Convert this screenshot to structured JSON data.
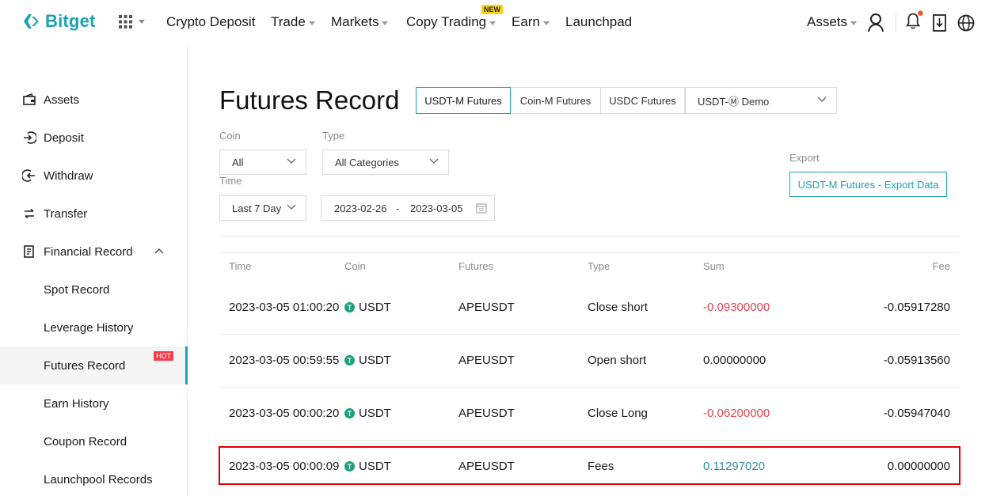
{
  "nav": {
    "logo": "Bitget",
    "items": [
      "Crypto Deposit",
      "Trade",
      "Markets",
      "Copy Trading",
      "Earn",
      "Launchpad"
    ],
    "new_badge": "NEW",
    "assets": "Assets"
  },
  "sidebar": {
    "items": [
      {
        "label": "Assets",
        "icon": "wallet-icon"
      },
      {
        "label": "Deposit",
        "icon": "deposit-icon"
      },
      {
        "label": "Withdraw",
        "icon": "withdraw-icon"
      },
      {
        "label": "Transfer",
        "icon": "transfer-icon"
      },
      {
        "label": "Financial Record",
        "icon": "document-icon"
      },
      {
        "label": "Spot Record"
      },
      {
        "label": "Leverage History"
      },
      {
        "label": "Futures Record",
        "badge": "HOT",
        "active": true
      },
      {
        "label": "Earn History"
      },
      {
        "label": "Coupon Record"
      },
      {
        "label": "Launchpool Records"
      }
    ]
  },
  "main": {
    "title": "Futures Record",
    "tabs": [
      "USDT-M Futures",
      "Coin-M Futures",
      "USDC Futures"
    ],
    "demo_select": "USDT-Ⓜ Demo",
    "filters": {
      "coin_label": "Coin",
      "coin_value": "All",
      "type_label": "Type",
      "type_value": "All Categories",
      "time_label": "Time",
      "time_value": "Last 7 Day",
      "date_from": "2023-02-26",
      "date_sep": "-",
      "date_to": "2023-03-05",
      "export_label": "Export",
      "export_button": "USDT-M Futures - Export Data"
    },
    "table": {
      "columns": [
        "Time",
        "Coin",
        "Futures",
        "Type",
        "Sum",
        "Fee"
      ],
      "rows": [
        {
          "time": "2023-03-05 01:00:20",
          "coin": "USDT",
          "futures": "APEUSDT",
          "type": "Close short",
          "sum": "-0.09300000",
          "fee": "-0.05917280"
        },
        {
          "time": "2023-03-05 00:59:55",
          "coin": "USDT",
          "futures": "APEUSDT",
          "type": "Open short",
          "sum": "0.00000000",
          "fee": "-0.05913560"
        },
        {
          "time": "2023-03-05 00:00:20",
          "coin": "USDT",
          "futures": "APEUSDT",
          "type": "Close Long",
          "sum": "-0.06200000",
          "fee": "-0.05947040"
        },
        {
          "time": "2023-03-05 00:00:09",
          "coin": "USDT",
          "futures": "APEUSDT",
          "type": "Fees",
          "sum": "0.11297020",
          "fee": "0.00000000"
        }
      ]
    },
    "colors": {
      "accent": "#1da2b4",
      "negative": "#e8464e",
      "positive": "#2e8ea8",
      "highlight": "#e00000"
    }
  }
}
